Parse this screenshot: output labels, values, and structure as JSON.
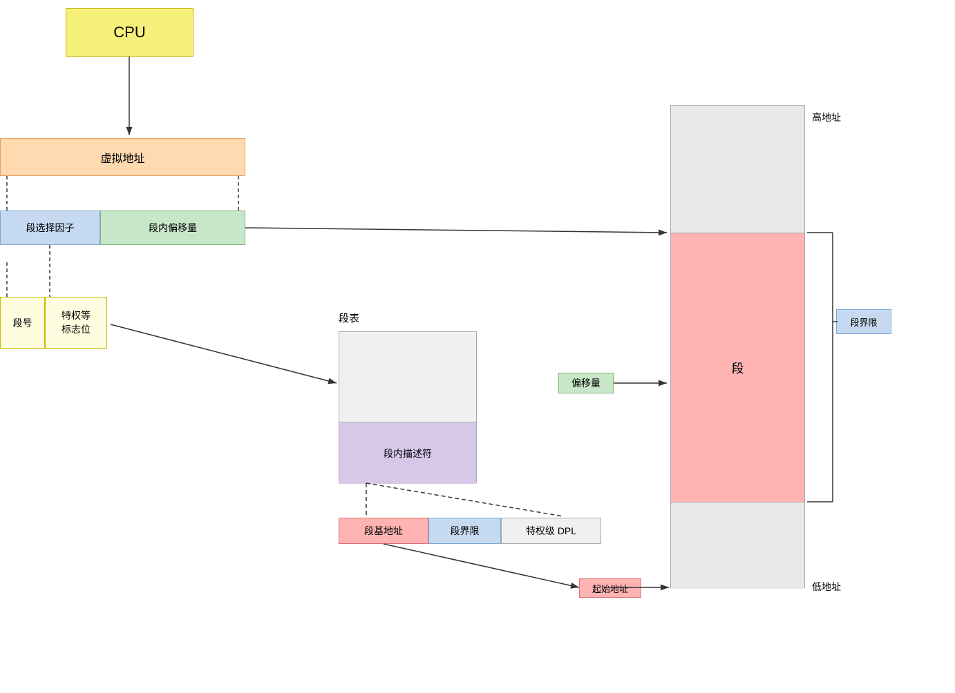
{
  "diagram": {
    "cpu": "CPU",
    "virtual_address": "虚拟地址",
    "segment_selector": "段选择因子",
    "segment_offset": "段内偏移量",
    "segment_number": "段号",
    "privilege_flag": "特权等\n标志位",
    "segment_table_label": "段表",
    "segment_descriptor": "段内描述符",
    "desc_base": "段基地址",
    "desc_limit": "段界限",
    "desc_dpl": "特权级 DPL",
    "memory_segment": "段",
    "high_address": "高地址",
    "low_address": "低地址",
    "seg_limit_badge": "段界限",
    "offset_badge": "偏移量",
    "start_address_badge": "起始地址"
  }
}
